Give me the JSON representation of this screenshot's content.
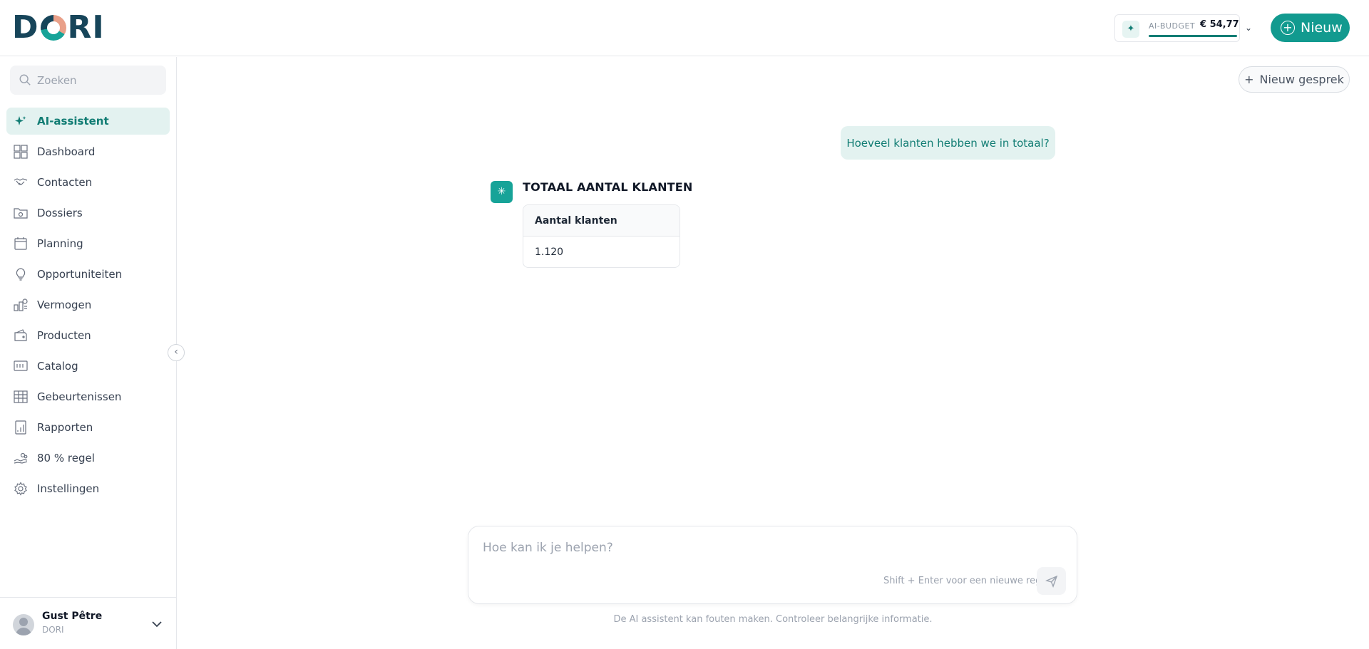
{
  "header": {
    "logo_text_left": "D",
    "logo_text_right": "RI",
    "budget": {
      "label": "AI-BUDGET",
      "value": "€ 54,77",
      "fill_percent": 100
    },
    "new_button_label": "Nieuw"
  },
  "sidebar": {
    "search_placeholder": "Zoeken",
    "items": [
      {
        "label": "AI-assistent",
        "icon": "sparkle-icon",
        "active": true
      },
      {
        "label": "Dashboard",
        "icon": "dashboard-grid-icon"
      },
      {
        "label": "Contacten",
        "icon": "handshake-icon"
      },
      {
        "label": "Dossiers",
        "icon": "folder-icon"
      },
      {
        "label": "Planning",
        "icon": "calendar-icon"
      },
      {
        "label": "Opportuniteiten",
        "icon": "lightbulb-icon"
      },
      {
        "label": "Vermogen",
        "icon": "wealth-icon"
      },
      {
        "label": "Producten",
        "icon": "wallet-icon"
      },
      {
        "label": "Catalog",
        "icon": "catalog-icon"
      },
      {
        "label": "Gebeurtenissen",
        "icon": "events-grid-icon"
      },
      {
        "label": "Rapporten",
        "icon": "report-icon"
      },
      {
        "label": "80 % regel",
        "icon": "hand-coins-icon"
      },
      {
        "label": "Instellingen",
        "icon": "gear-icon"
      }
    ],
    "user": {
      "name": "Gust Pêtre",
      "org": "DORI"
    }
  },
  "main": {
    "new_chat_label": "Nieuw gesprek",
    "user_message": "Hoeveel klanten hebben we in totaal?",
    "bot": {
      "title": "TOTAAL AANTAL KLANTEN",
      "table_header": "Aantal klanten",
      "table_value": "1.120"
    },
    "composer": {
      "placeholder": "Hoe kan ik je helpen?",
      "hint": "Shift + Enter voor een nieuwe regel"
    },
    "disclaimer": "De AI assistent kan fouten maken. Controleer belangrijke informatie."
  }
}
